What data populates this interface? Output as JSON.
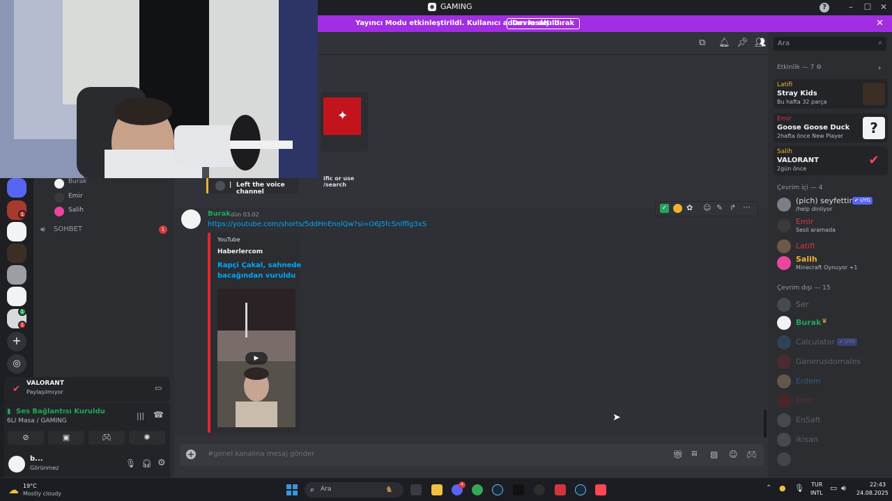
{
  "window": {
    "title": "GAMING",
    "title_icon": "discord-logo"
  },
  "banner": {
    "message": "Yayıncı Modu etkinleştirildi. Kullanıcı adları kısaltıldı.",
    "button_label": "Devre dışı bırak",
    "bg": "#a12ee2"
  },
  "header": {
    "search_placeholder": "Ara"
  },
  "top_embed": {
    "text": "ific or use /search"
  },
  "voice_left": {
    "text": "Left the voice channel"
  },
  "channels": {
    "voice_members": [
      "Burak",
      "Emir",
      "Salih"
    ],
    "text_channel": "SOHBET",
    "text_channel_badge": "1"
  },
  "servers": {
    "badges": [
      "1",
      "1",
      "1"
    ]
  },
  "activity_panel": {
    "game": "VALORANT",
    "status": "Paylaşılmıyor"
  },
  "voice_panel": {
    "status": "Ses Bağlantısı Kuruldu",
    "channel": "6LI Masa / GAMING"
  },
  "user_panel": {
    "name": "b...",
    "status": "Görünmez"
  },
  "message": {
    "author": "Burak",
    "time": "dün 03:02",
    "link": "https://youtube.com/shorts/5ddHnEnolQw?si=O6J5fcSnlfflg3xS",
    "embed": {
      "provider": "YouTube",
      "author": "Haberlercom",
      "title_line1": "Rapçi Çakal, sahnede",
      "title_line2": "bacağından vuruldu"
    }
  },
  "composer": {
    "placeholder": "#genel kanalına mesaj gönder"
  },
  "members": {
    "activity_header": "Etkinlik — 7",
    "activities": [
      {
        "user": "Latifi",
        "game": "Stray Kids",
        "meta": "Bu hafta 32 parça",
        "color": "#f0b232"
      },
      {
        "user": "Emir",
        "game": "Goose Goose Duck",
        "meta": "2hafta önce  New Player",
        "color": "#da373c"
      },
      {
        "user": "Salih",
        "game": "VALORANT",
        "meta": "2gün önce",
        "color": "#f0b232"
      }
    ],
    "online_header": "Çevrim içi — 4",
    "online": [
      {
        "name": "(pich) seyfettin",
        "tag": "UYG",
        "sub": "/help dinliyor",
        "color": "#dbdee1"
      },
      {
        "name": "Emir",
        "sub": "Sesli aramada",
        "color": "#da373c"
      },
      {
        "name": "Latifi",
        "sub": "",
        "color": "#da373c"
      },
      {
        "name": "Salih",
        "sub": "Minecraft Oynuyor +1",
        "color": "#f0b232"
      }
    ],
    "offline_header": "Çevrim dışı — 15",
    "offline": [
      {
        "name": "Ser",
        "color": "#6d6f78"
      },
      {
        "name": "Burak",
        "color": "#23a55a"
      },
      {
        "name": "Calculator",
        "tag": "UYG",
        "color": "#6d6f78"
      },
      {
        "name": "Ganerusdomales",
        "color": "#6d6f78"
      },
      {
        "name": "Erdem",
        "color": "#3a6d96"
      },
      {
        "name": "Emir",
        "color": "#6b2b2b"
      },
      {
        "name": "EnSaft",
        "color": "#6d6f78"
      },
      {
        "name": "ikisan",
        "color": "#6d6f78"
      },
      {
        "name": "",
        "color": "#6b2b2b"
      }
    ]
  },
  "taskbar": {
    "weather_temp": "19°C",
    "weather_desc": "Mostly cloudy",
    "search_label": "Ara",
    "lang1": "TUR",
    "lang2": "INTL",
    "time": "22:43",
    "date": "24.08.2025",
    "discord_badge": "4"
  }
}
